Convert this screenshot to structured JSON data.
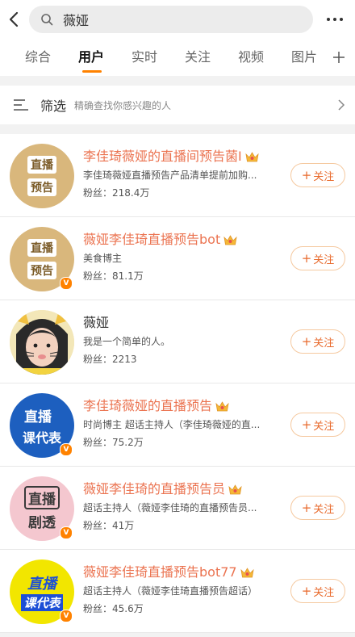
{
  "search": {
    "query": "薇娅"
  },
  "tabs": [
    {
      "label": "综合",
      "active": false
    },
    {
      "label": "用户",
      "active": true
    },
    {
      "label": "实时",
      "active": false
    },
    {
      "label": "关注",
      "active": false
    },
    {
      "label": "视频",
      "active": false
    },
    {
      "label": "图片",
      "active": false
    }
  ],
  "filter": {
    "label": "筛选",
    "hint": "精确查找你感兴趣的人"
  },
  "follow_label": "关注",
  "users": [
    {
      "name": "李佳琦薇娅的直播间预告菌I",
      "desc": "李佳琦薇娅直播预告产品清单提前加购...",
      "fans": "粉丝：218.4万",
      "avatar_text": [
        "直播",
        "预告"
      ],
      "verified": false
    },
    {
      "name": "薇娅李佳琦直播预告bot",
      "desc": "美食博主",
      "fans": "粉丝：81.1万",
      "avatar_text": [
        "直播",
        "预告"
      ],
      "verified": true
    },
    {
      "name": "薇娅",
      "desc": "我是一个简单的人。",
      "fans": "粉丝：2213",
      "avatar_text": [],
      "verified": false
    },
    {
      "name": "李佳琦薇娅的直播预告",
      "desc": "时尚博主 超话主持人（李佳琦薇娅的直...",
      "fans": "粉丝：75.2万",
      "avatar_text": [
        "直播",
        "课代表"
      ],
      "verified": true
    },
    {
      "name": "薇娅李佳琦的直播预告员",
      "desc": "超话主持人（薇娅李佳琦的直播预告员...",
      "fans": "粉丝：41万",
      "avatar_text": [
        "直播",
        "剧透"
      ],
      "verified": true
    },
    {
      "name": "薇娅李佳琦直播预告bot77",
      "desc": "超话主持人（薇娅李佳琦直播预告超话）",
      "fans": "粉丝：45.6万",
      "avatar_text": [
        "直播",
        "课代表"
      ],
      "verified": true
    }
  ],
  "colors": {
    "accent": "#ff8200",
    "name_highlight": "#eb7350",
    "follow": "#e86a2c"
  },
  "icons": [
    "back-arrow-icon",
    "search-icon",
    "more-dots-icon",
    "add-tab-icon",
    "filter-list-icon",
    "chevron-right-icon",
    "crown-badge-icon",
    "verified-badge-icon"
  ]
}
